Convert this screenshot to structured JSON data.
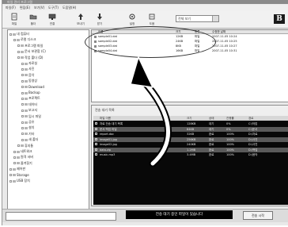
{
  "window": {
    "title": "파일 관리 프로그램"
  },
  "menu": [
    "파일(F)",
    "편집(E)",
    "보기(V)",
    "도구(T)",
    "도움말(H)"
  ],
  "toolbar": {
    "buttons": [
      {
        "label": "파일",
        "icon": "file-icon"
      },
      {
        "label": "폴더",
        "icon": "folder-icon"
      },
      {
        "label": "연결",
        "icon": "connect-icon"
      },
      {
        "label": "보내기",
        "icon": "upload-icon"
      },
      {
        "label": "받기",
        "icon": "download-icon"
      },
      {
        "label": "설정",
        "icon": "settings-icon"
      },
      {
        "label": "도움",
        "icon": "help-icon"
      }
    ],
    "combo_value": "전체 보기",
    "brand": "B"
  },
  "tree": [
    {
      "label": "내 컴퓨터",
      "level": 0,
      "open": true
    },
    {
      "label": "로컬 디스크",
      "level": 1,
      "open": true
    },
    {
      "label": "프로그램 파일",
      "level": 2,
      "open": true
    },
    {
      "label": "문서 보관함 (C)",
      "level": 2,
      "open": true
    },
    {
      "label": "작업 폴더 (D)",
      "level": 2,
      "open": true
    },
    {
      "label": "자료실",
      "level": 3
    },
    {
      "label": "사진",
      "level": 3
    },
    {
      "label": "음악",
      "level": 3
    },
    {
      "label": "동영상",
      "level": 3
    },
    {
      "label": "Download",
      "level": 3
    },
    {
      "label": "Backup",
      "level": 3
    },
    {
      "label": "프로젝트",
      "level": 3
    },
    {
      "label": "데이터",
      "level": 3
    },
    {
      "label": "보고서",
      "level": 3
    },
    {
      "label": "임시 파일",
      "level": 3
    },
    {
      "label": "공유",
      "level": 3
    },
    {
      "label": "설치",
      "level": 3
    },
    {
      "label": "기타",
      "level": 3
    },
    {
      "label": "새 폴더",
      "level": 3
    },
    {
      "label": "휴지통",
      "level": 2
    },
    {
      "label": "네트워크",
      "level": 1
    },
    {
      "label": "원격 서버",
      "level": 1
    },
    {
      "label": "즐겨찾기",
      "level": 1
    },
    {
      "label": "제어판",
      "level": 0
    },
    {
      "label": "Storage",
      "level": 0
    },
    {
      "label": "USB 장치",
      "level": 0
    }
  ],
  "list": {
    "headers": [
      "이름",
      "크기",
      "종류",
      "수정한 날짜"
    ],
    "rows": [
      {
        "name": "sample01.dat",
        "size": "12KB",
        "type": "파일",
        "date": "2007-11-05 10:24"
      },
      {
        "name": "sample02.dat",
        "size": "24KB",
        "type": "파일",
        "date": "2007-11-05 10:25"
      },
      {
        "name": "sample03.dat",
        "size": "8KB",
        "type": "파일",
        "date": "2007-11-05 10:27"
      },
      {
        "name": "sample04.dat",
        "size": "16KB",
        "type": "파일",
        "date": "2007-11-05 10:31"
      }
    ]
  },
  "transfer": {
    "caption": "전송 대기 목록",
    "headers": [
      "파일 이름",
      "크기",
      "상태",
      "진행률",
      "경로"
    ],
    "rows": [
      {
        "name": "자료 전송 대기 목록",
        "size": "128KB",
        "status": "대기",
        "progress": "0%",
        "path": "C:\\작업"
      },
      {
        "name": "문서 백업 파일",
        "size": "64KB",
        "status": "대기",
        "progress": "0%",
        "path": "C:\\문서"
      },
      {
        "name": "report.doc",
        "size": "32KB",
        "status": "완료",
        "progress": "100%",
        "path": "D:\\자료"
      },
      {
        "name": "image01.jpg",
        "size": "256KB",
        "status": "완료",
        "progress": "100%",
        "path": "D:\\사진"
      },
      {
        "name": "image02.jpg",
        "size": "240KB",
        "status": "완료",
        "progress": "100%",
        "path": "D:\\사진"
      },
      {
        "name": "data.zip",
        "size": "1.2MB",
        "status": "완료",
        "progress": "100%",
        "path": "D:\\백업"
      },
      {
        "name": "music.mp3",
        "size": "3.4MB",
        "status": "완료",
        "progress": "100%",
        "path": "D:\\음악"
      }
    ]
  },
  "status": {
    "message": "전송 대기 중인 파일이 있습니다",
    "button": "전송 시작"
  }
}
